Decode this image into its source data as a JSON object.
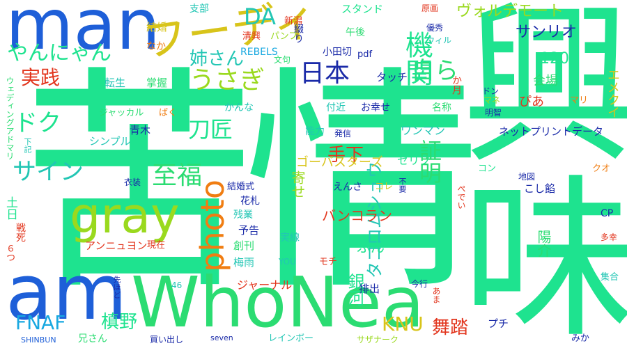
{
  "colors": {
    "mint": "#1ee38f",
    "green": "#2bdc72",
    "lime": "#6bd63a",
    "chartreuse": "#9ad91e",
    "yellow": "#d8c41a",
    "orange": "#f07d12",
    "red": "#e2351d",
    "blue": "#1e5fd8",
    "navy": "#1a2aa8",
    "sky": "#18a8e0",
    "teal": "#22c6b4",
    "aqua": "#31d6c2"
  },
  "words": {
    "kujou": "苦情",
    "kyomi": "興味",
    "man": "man",
    "am": "am",
    "whonea": "WhoNea",
    "gray": "gray",
    "photo": "photo",
    "fudi": "フーディ",
    "jibun": "自ら",
    "kikan": "機関",
    "nihon": "日本",
    "usagi": "うさぎ",
    "yannyan": "やんにゃん",
    "jissen": "実践",
    "doku": "ドク",
    "katana": "刀匠",
    "shifuku": "至福",
    "sain": "サイン",
    "shomei": "証明",
    "teshita": "手下",
    "anesan": "姉さん",
    "da": "DA",
    "voldemort": "ヴォルデモート",
    "sanrio": "サンリオ",
    "sanbyaku": "120",
    "kaijou": "会場",
    "emukui": "エメクイ",
    "fnaf": "FNAF",
    "makino": "槙野",
    "knu": "KNU",
    "butou": "舞踏",
    "ginga": "銀河",
    "takoromu": "タコロムシュウ",
    "yousuke": "陽介",
    "fun": "ふん",
    "bankoran": "バンコラン",
    "ghostbusters": "ゴーバスターズ",
    "serifu": "セリフ",
    "netprint": "ネットプリントデータ",
    "wanman": "ワンマン",
    "touch": "タッチ",
    "pia": "ぴあ",
    "kagetsu": "か月",
    "shibu": "支部",
    "kekkon": "結婚",
    "seikyou": "清興",
    "pamphlet": "パンフ",
    "niigata": "新潟",
    "stand": "スタンド",
    "gogo": "午後",
    "tsuzuri": "綴り",
    "rebels": "REBELS",
    "odagiri": "小田切",
    "pdf": "pdf",
    "bunku": "文句",
    "gensaku": "原画",
    "yuushuu": "優秀",
    "will": "ウィル",
    "tensei": "転生",
    "shouaku": "掌握",
    "naka": "なか",
    "wedding": "ウェディングアドマリ",
    "kanna": "かんな",
    "fukin": "付近",
    "oshiawase": "お幸せ",
    "meishou": "名称",
    "don": "ドン",
    "mane": "マネ",
    "mari": "マリ",
    "meichi": "明智",
    "jackal": "ジャッカル",
    "baku": "ばく",
    "aoki": "青木",
    "nouryoku": "能力",
    "hasshin": "発信",
    "simple": "シンプル",
    "kaki": "下記",
    "kon": "コン",
    "kuo": "クオ",
    "yosei": "寄せ",
    "ishou": "衣装",
    "kekkonshiki": "結婚式",
    "hanafuda": "花札",
    "zangyou": "残業",
    "yokoku": "予告",
    "anion": "アンニュヨン",
    "souhan": "創刊",
    "genzai": "現在",
    "jissen2": "実線",
    "baiu": "梅雨",
    "mochi": "モチ",
    "you": "YOU",
    "tsuchi": "土日",
    "mitsu": "６つ",
    "senshi": "戦死",
    "yonroku": "46",
    "sakihodo": "先ほど",
    "journal": "ジャーナル",
    "haishutsu": "排出",
    "petit": "プチ",
    "kimmen": "今行",
    "ama": "あま",
    "shuugou": "集合",
    "tabun": "多幸",
    "cp": "CP",
    "chizu": "地図",
    "koshiame": "こし餡",
    "fuyou": "不要",
    "pedei": "ぺでい",
    "kore": "コレ",
    "ensa": "えんさ",
    "shinbun": "SHINBUN",
    "niisan": "兄さん",
    "kaidashi": "買い出し",
    "seven": "seven",
    "rainbow": "レインボー",
    "sazanaku": "サザナーク",
    "mika": "みか"
  }
}
